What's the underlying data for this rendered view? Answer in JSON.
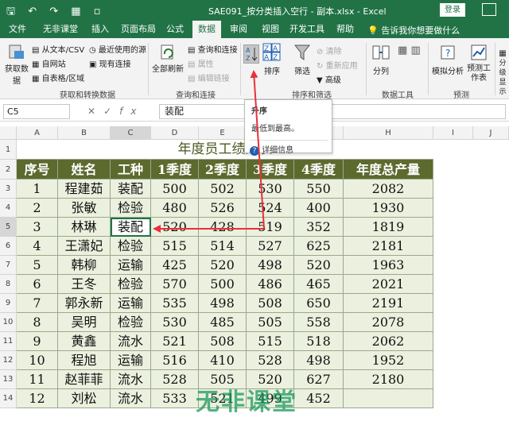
{
  "titlebar": {
    "quick_access": "🖫 ↶ ↷ ▦ ▫",
    "title": "SAE091_按分类插入空行 - 副本.xlsx - Excel",
    "login_label": "登录",
    "accent": "#217346"
  },
  "tabs": [
    "文件",
    "无非课堂",
    "插入",
    "页面布局",
    "公式",
    "数据",
    "审阅",
    "视图",
    "开发工具",
    "帮助"
  ],
  "tell_me": "告诉我你想要做什么",
  "ribbon": {
    "get_data": "获取数据",
    "from_text_csv": "从文本/CSV",
    "from_web": "自网站",
    "from_table": "自表格/区域",
    "recent_sources": "最近使用的源",
    "existing_conn": "现有连接",
    "group_get": "获取和转换数据",
    "refresh_all": "全部刷新",
    "queries_conn": "查询和连接",
    "properties": "属性",
    "edit_links": "编辑链接",
    "group_queries": "查询和连接",
    "sort": "排序",
    "filter": "筛选",
    "clear": "清除",
    "reapply": "重新应用",
    "advanced": "高级",
    "group_sort": "排序和筛选",
    "text_to_cols": "分列",
    "group_tools": "数据工具",
    "what_if": "模拟分析",
    "forecast_sheet": "预测工作表",
    "group_forecast": "预测",
    "outline": "分级显示"
  },
  "formula_bar": {
    "name_box": "C5",
    "value": "装配"
  },
  "tooltip": {
    "title": "升序",
    "desc": "最低到最高。",
    "more": "详细信息"
  },
  "columns": [
    "A",
    "B",
    "C",
    "D",
    "E",
    "F",
    "G",
    "H",
    "I",
    "J"
  ],
  "rows": [
    "1",
    "2",
    "3",
    "4",
    "5",
    "6",
    "7",
    "8",
    "9",
    "10",
    "11",
    "12",
    "13",
    "14"
  ],
  "sheet": {
    "title": "年度员工绩效表",
    "headers": [
      "序号",
      "姓名",
      "工种",
      "1季度",
      "2季度",
      "3季度",
      "4季度",
      "年度总产量"
    ],
    "data": [
      [
        "1",
        "程建茹",
        "装配",
        "500",
        "502",
        "530",
        "550",
        "2082"
      ],
      [
        "2",
        "张敏",
        "检验",
        "480",
        "526",
        "524",
        "400",
        "1930"
      ],
      [
        "3",
        "林琳",
        "装配",
        "520",
        "428",
        "519",
        "352",
        "1819"
      ],
      [
        "4",
        "王潇妃",
        "检验",
        "515",
        "514",
        "527",
        "625",
        "2181"
      ],
      [
        "5",
        "韩柳",
        "运输",
        "425",
        "520",
        "498",
        "520",
        "1963"
      ],
      [
        "6",
        "王冬",
        "检验",
        "570",
        "500",
        "486",
        "465",
        "2021"
      ],
      [
        "7",
        "郭永新",
        "运输",
        "535",
        "498",
        "508",
        "650",
        "2191"
      ],
      [
        "8",
        "吴明",
        "检验",
        "530",
        "485",
        "505",
        "558",
        "2078"
      ],
      [
        "9",
        "黄鑫",
        "流水",
        "521",
        "508",
        "515",
        "518",
        "2062"
      ],
      [
        "10",
        "程旭",
        "运输",
        "516",
        "410",
        "528",
        "498",
        "1952"
      ],
      [
        "11",
        "赵菲菲",
        "流水",
        "528",
        "505",
        "520",
        "627",
        "2180"
      ],
      [
        "12",
        "刘松",
        "流水",
        "533",
        "521",
        "499",
        "452",
        ""
      ]
    ],
    "header_bg": "#5c6a2e",
    "body_bg": "#ebf1de"
  },
  "watermark": "无非课堂",
  "arrow_color": "#e8313b"
}
